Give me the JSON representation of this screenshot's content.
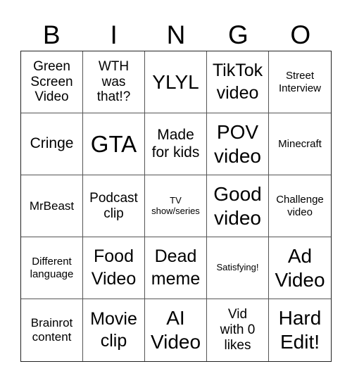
{
  "header": [
    "B",
    "I",
    "N",
    "G",
    "O"
  ],
  "cells": [
    [
      "Green\nScreen\nVideo",
      "WTH\nwas\nthat!?",
      "YLYL",
      "TikTok\nvideo",
      "Street\nInterview"
    ],
    [
      "Cringe",
      "GTA",
      "Made\nfor kids",
      "POV\nvideo",
      "Minecraft"
    ],
    [
      "MrBeast",
      "Podcast\nclip",
      "TV\nshow/series",
      "Good\nvideo",
      "Challenge\nvideo"
    ],
    [
      "Different\nlanguage",
      "Food\nVideo",
      "Dead\nmeme",
      "Satisfying!",
      "Ad\nVideo"
    ],
    [
      "Brainrot\ncontent",
      "Movie\nclip",
      "AI\nVideo",
      "Vid\nwith 0\nlikes",
      "Hard\nEdit!"
    ]
  ]
}
